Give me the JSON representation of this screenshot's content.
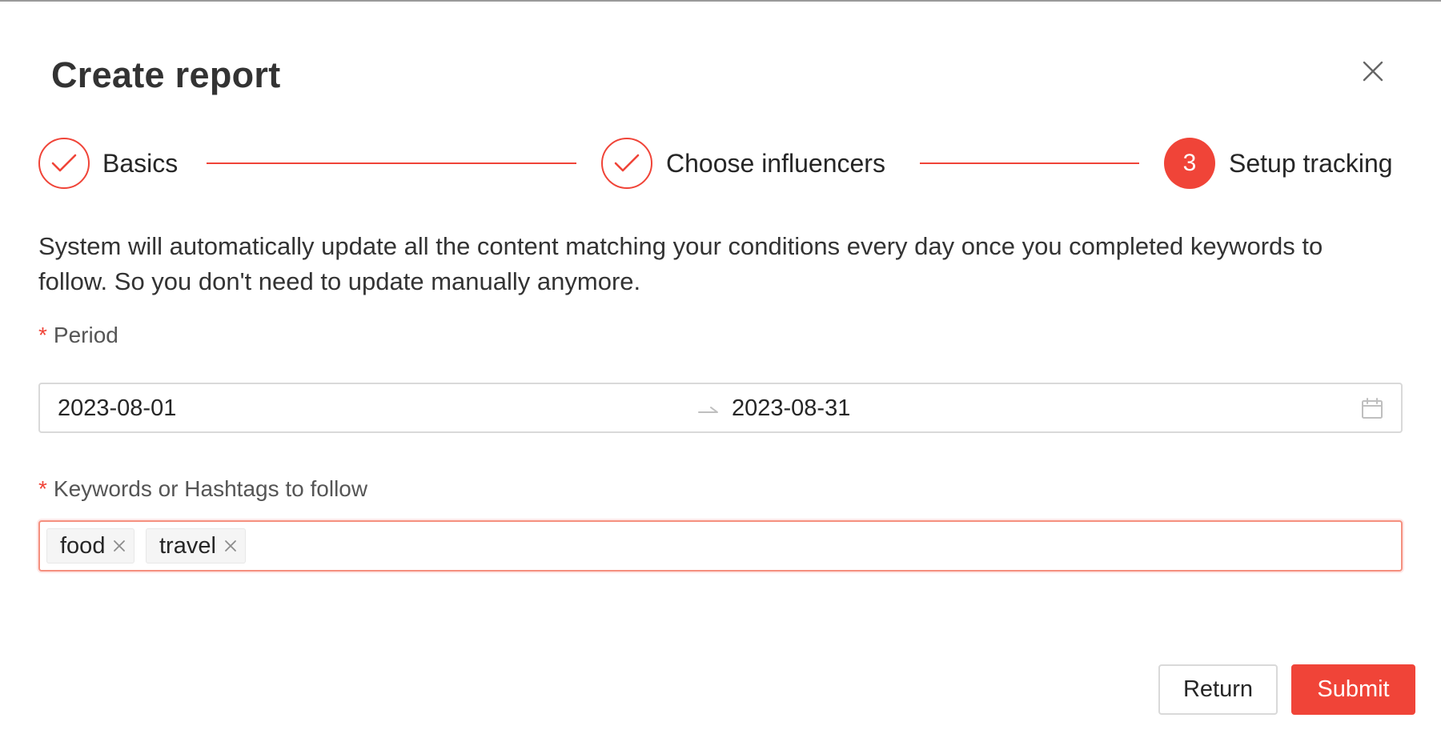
{
  "modal": {
    "title": "Create report"
  },
  "steps": [
    {
      "label": "Basics",
      "status": "done"
    },
    {
      "label": "Choose influencers",
      "status": "done"
    },
    {
      "label": "Setup tracking",
      "status": "active",
      "number": "3"
    }
  ],
  "description": "System will automatically update all the content matching your conditions every day once you completed keywords to follow. So you don't need to update manually anymore.",
  "period": {
    "required_mark": "*",
    "label": "Period",
    "start_date": "2023-08-01",
    "end_date": "2023-08-31"
  },
  "keywords": {
    "required_mark": "*",
    "label": "Keywords or Hashtags to follow",
    "tags": [
      "food",
      "travel"
    ]
  },
  "footer": {
    "return_label": "Return",
    "submit_label": "Submit"
  },
  "colors": {
    "accent": "#f04438",
    "border": "#d9d9d9",
    "tag_bg": "#f5f5f5"
  }
}
